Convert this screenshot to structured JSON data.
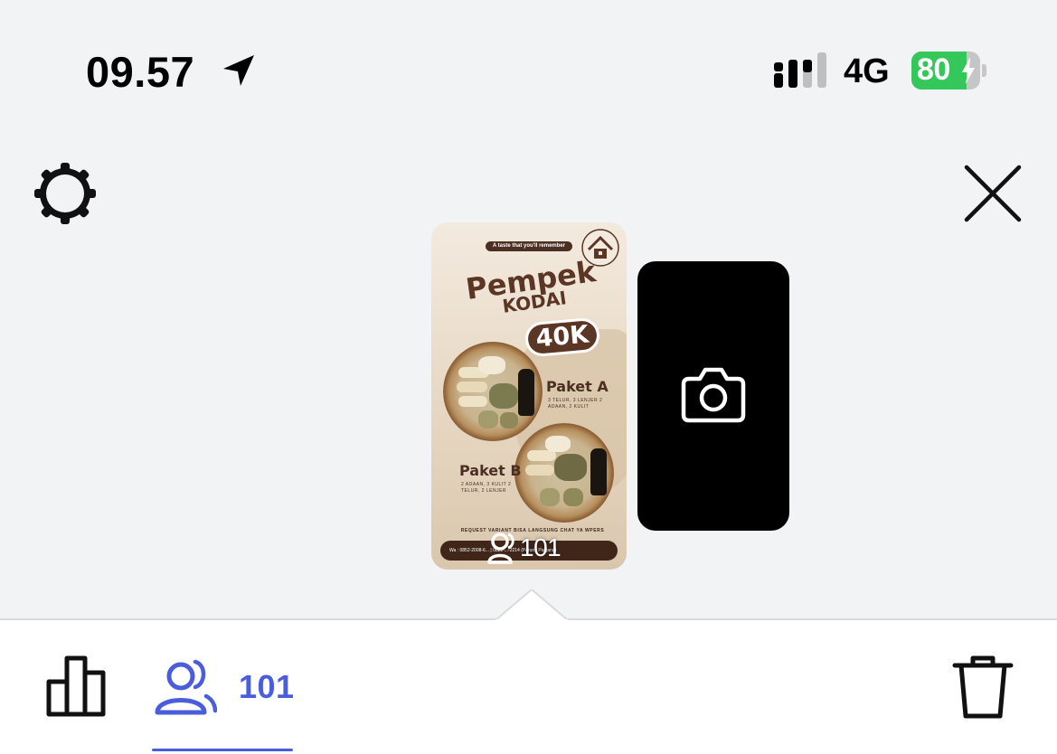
{
  "status_bar": {
    "time": "09.57",
    "network": "4G",
    "battery_level": "80",
    "location_icon": "location-arrow-icon",
    "signal_icon": "cellular-signal-icon",
    "battery_icon": "battery-charging-icon",
    "battery_color": "#34c759"
  },
  "toolbar": {
    "settings_icon": "gear-icon",
    "close_icon": "close-icon"
  },
  "story": {
    "viewer_count": "101",
    "poster": {
      "tagline": "A taste that you'll remember",
      "title": "Pempek",
      "subtitle": "KODAI",
      "price": "40K",
      "package_a": "Paket A",
      "package_a_desc": "3 TELUR, 3 LENJER 2 ADAAN, 2 KULIT",
      "package_b": "Paket B",
      "package_b_desc": "2 ADAAN, 3 KULIT 2 TELUR, 2 LENJER",
      "note": "REQUEST VARIANT BISA LANGSUNG CHAT YA WPERS",
      "footer": "Wa : 0852-2008-6... | 0821-...-2214 (Parung Panjang)"
    }
  },
  "add_story": {
    "icon": "camera-icon"
  },
  "bottom_bar": {
    "insights_icon": "bar-chart-icon",
    "viewers_icon": "viewers-icon",
    "viewers_count": "101",
    "delete_icon": "trash-icon",
    "accent_color": "#4a5ddb"
  }
}
